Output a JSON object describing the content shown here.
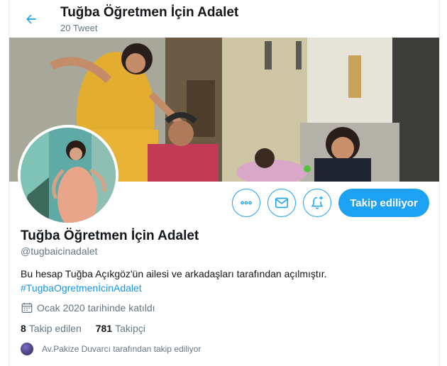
{
  "header": {
    "title": "Tuğba Öğretmen İçin Adalet",
    "tweet_count": "20 Tweet"
  },
  "profile": {
    "name": "Tuğba Öğretmen İçin Adalet",
    "handle": "@tugbaicinadalet",
    "bio_text": "Bu hesap Tuğba Açıkgöz'ün ailesi ve arkadaşları tarafından açılmıştır.",
    "bio_hashtag": "#TugbaOgretmenİcinAdalet",
    "joined": "Ocak 2020 tarihinde katıldı",
    "following_count": "8",
    "following_label": "Takip edilen",
    "followers_count": "781",
    "followers_label": "Takipçi",
    "followed_by": "Av.Pakize Duvarcı tarafından takip ediliyor"
  },
  "actions": {
    "follow_label": "Takip ediliyor"
  },
  "colors": {
    "accent": "#1da1f2",
    "text_secondary": "#657786",
    "link": "#1b95e0"
  },
  "icons": {
    "back": "arrow-left-icon",
    "more": "more-icon",
    "message": "envelope-icon",
    "notify": "bell-plus-icon",
    "calendar": "calendar-icon"
  }
}
